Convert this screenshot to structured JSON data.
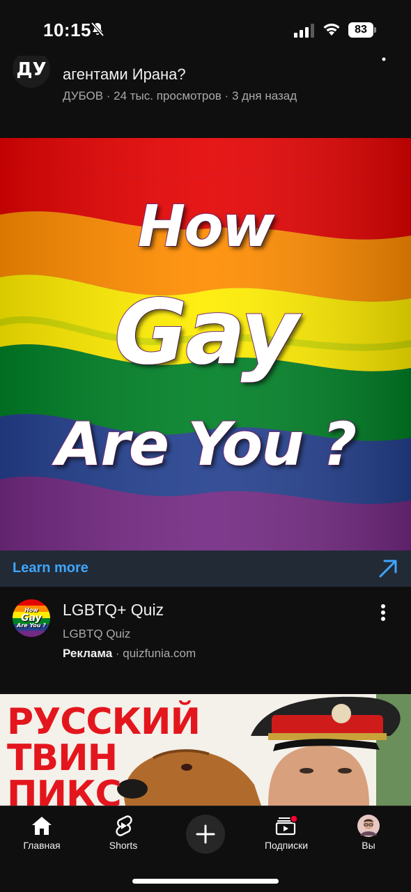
{
  "status_bar": {
    "time": "10:15",
    "battery": "83",
    "icons": [
      "bell-slash-icon",
      "signal-icon",
      "wifi-icon",
      "battery-icon"
    ]
  },
  "prev_video": {
    "title": "агентами Ирана?",
    "channel": "ДУБОВ",
    "meta": "ДУБОВ · 24 тыс. просмотров · 3 дня назад",
    "avatar_text": "ДУ"
  },
  "ad": {
    "thumb_line1": "How",
    "thumb_line2": "Gay",
    "thumb_line3": "Are You ?",
    "learn_more": "Learn more",
    "title": "LGBTQ+ Quiz",
    "channel": "LGBTQ Quiz",
    "sponsored_label": "Реклама",
    "sponsored_domain": " · quizfunia.com",
    "avatar_line1": "How",
    "avatar_line2": "Gay",
    "avatar_line3": "Are You ?",
    "colors": {
      "link": "#3ea6ff",
      "bar": "#222a36",
      "flag": [
        "#e40303",
        "#ff8c00",
        "#ffed00",
        "#008026",
        "#24408e",
        "#732982"
      ]
    }
  },
  "next_video": {
    "line1": "РУССКИЙ",
    "line2": "ТВИН",
    "line3": "ПИКС"
  },
  "nav": {
    "home": "Главная",
    "shorts": "Shorts",
    "subscriptions": "Подписки",
    "you": "Вы"
  }
}
